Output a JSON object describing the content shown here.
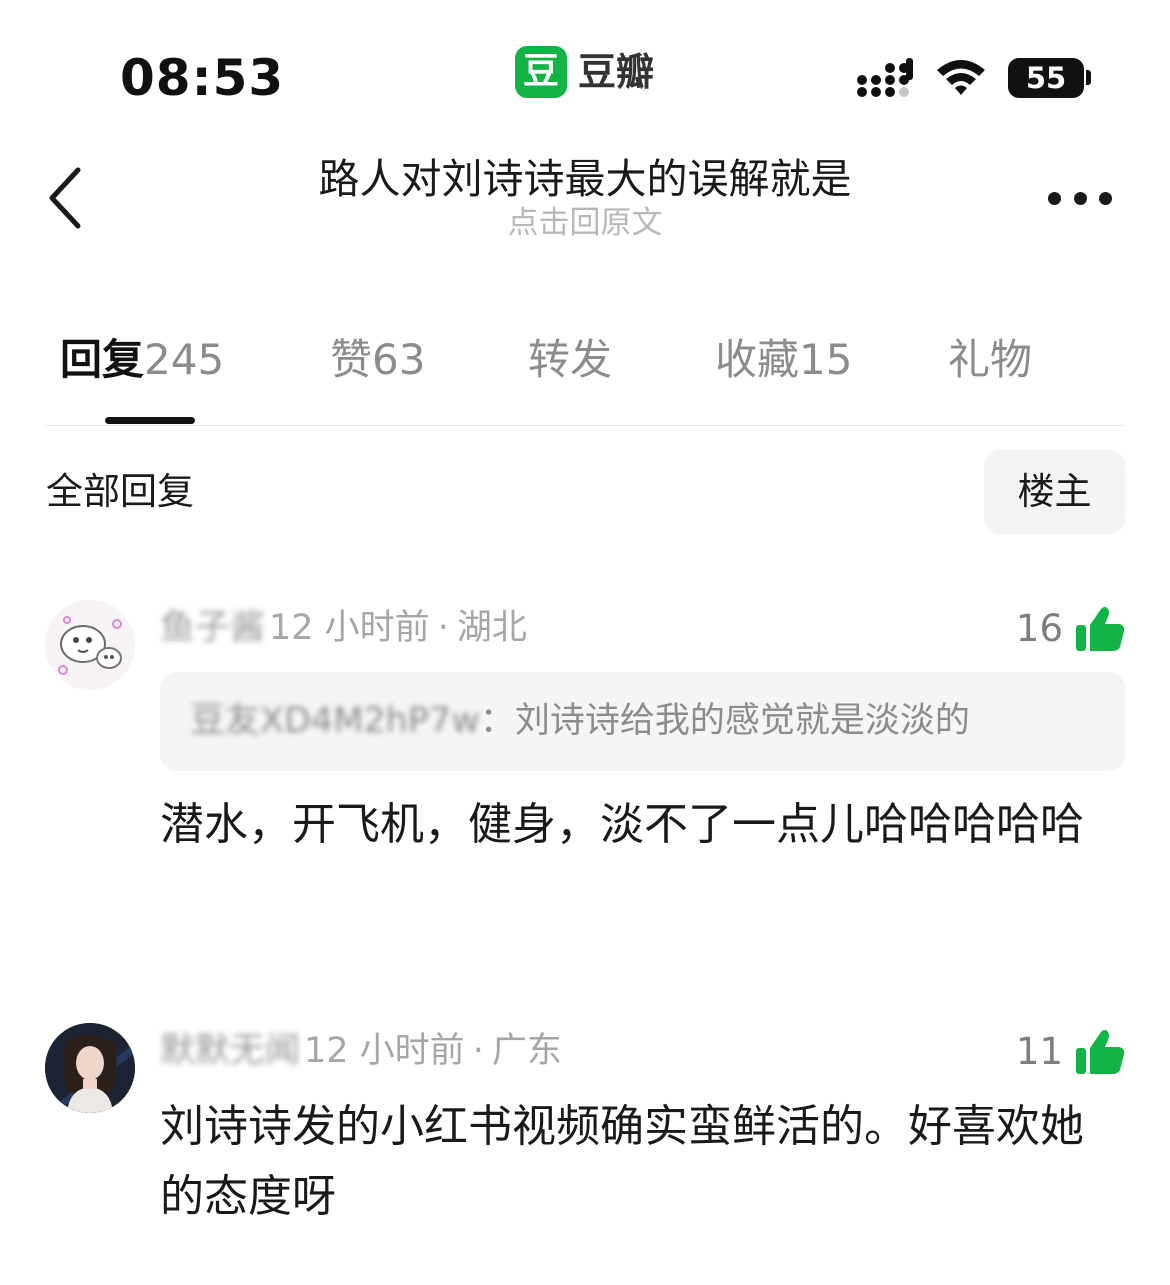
{
  "status_bar": {
    "time": "08:53",
    "app_badge": "豆",
    "app_name": "豆瓣",
    "battery": "55"
  },
  "nav": {
    "title": "路人对刘诗诗最大的误解就是",
    "subtitle": "点击回原文"
  },
  "tabs": [
    {
      "label": "回复",
      "count": "245",
      "active": true
    },
    {
      "label": "赞",
      "count": "63"
    },
    {
      "label": "转发",
      "count": ""
    },
    {
      "label": "收藏",
      "count": "15"
    },
    {
      "label": "礼物",
      "count": ""
    }
  ],
  "section": {
    "title": "全部回复",
    "op_filter": "楼主"
  },
  "comments": [
    {
      "username": "鱼子酱",
      "time": "12 小时前",
      "location": "湖北",
      "likes": "16",
      "quote_user": "豆友XD4M2hP7w",
      "quote_text": "刘诗诗给我的感觉就是淡淡的",
      "text": "潜水，开飞机，健身，淡不了一点儿哈哈哈哈哈"
    },
    {
      "username": "默默无闻",
      "time": "12 小时前",
      "location": "广东",
      "likes": "11",
      "text": "刘诗诗发的小红书视频确实蛮鲜活的。好喜欢她的态度呀"
    }
  ],
  "colors": {
    "douban_green": "#12b545",
    "like_green": "#12b545"
  },
  "icons": {
    "back": "chevron-left-icon",
    "more": "more-horizontal-icon",
    "like": "thumbs-up-icon",
    "signal": "cellular-signal-icon",
    "wifi": "wifi-icon"
  }
}
